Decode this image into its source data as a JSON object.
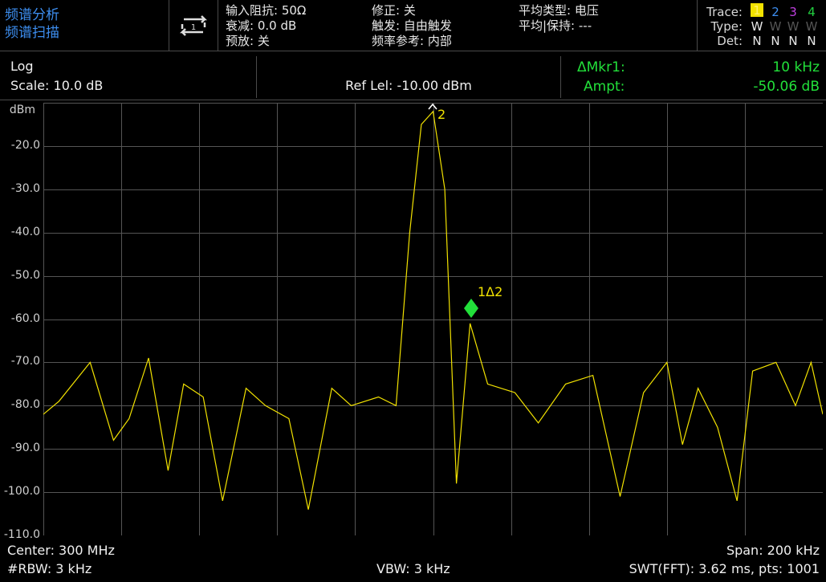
{
  "mode": {
    "line1": "频谱分析",
    "line2": "频谱扫描"
  },
  "status": {
    "col1": [
      "输入阻抗: 50Ω",
      "衰减: 0.0 dB",
      "预放: 关"
    ],
    "col2": [
      "修正: 关",
      "触发: 自由触发",
      "频率参考: 内部"
    ],
    "col3": [
      "平均类型: 电压",
      "平均|保持: ---"
    ]
  },
  "trace_panel": {
    "trace_label": "Trace:",
    "type_label": "Type:",
    "det_label": "Det:",
    "numbers": [
      "1",
      "2",
      "3",
      "4"
    ],
    "types": [
      "W",
      "W",
      "W",
      "W"
    ],
    "dets": [
      "N",
      "N",
      "N",
      "N"
    ],
    "colors": [
      "#f2e200",
      "#3d8ef0",
      "#c040e0",
      "#22d040"
    ]
  },
  "scale": {
    "mode": "Log",
    "scale_text": "Scale: 10.0 dB",
    "ref_level": "Ref Lel: -10.00 dBm"
  },
  "marker_readout": {
    "label": "ΔMkr1:",
    "value": "10 kHz",
    "ampt_label": "Ampt:",
    "ampt_value": "-50.06 dB"
  },
  "y_axis": {
    "unit": "dBm",
    "ticks": [
      "-20.0",
      "-30.0",
      "-40.0",
      "-50.0",
      "-60.0",
      "-70.0",
      "-80.0",
      "-90.0",
      "-100.0",
      "-110.0"
    ]
  },
  "markers": {
    "ref_label": "2",
    "delta_label": "1Δ2"
  },
  "footer": {
    "center": "Center: 300 MHz",
    "rbw": "#RBW: 3 kHz",
    "vbw": "VBW: 3 kHz",
    "span": "Span: 200 kHz",
    "swt": "SWT(FFT): 3.62 ms, pts: 1001"
  },
  "chart_data": {
    "type": "line",
    "xlabel": "",
    "ylabel": "dBm",
    "xlim": [
      299.9,
      300.1
    ],
    "ylim": [
      -110,
      -10
    ],
    "series": [
      {
        "values_x": [
          299.9,
          299.904,
          299.912,
          299.918,
          299.922,
          299.927,
          299.932,
          299.936,
          299.941,
          299.946,
          299.952,
          299.957,
          299.963,
          299.968,
          299.974,
          299.979,
          299.986,
          299.9905,
          299.994,
          299.997,
          300.0,
          300.003,
          300.006,
          300.0095,
          300.014,
          300.021,
          300.027,
          300.034,
          300.041,
          300.048,
          300.054,
          300.06,
          300.064,
          300.068,
          300.073,
          300.078,
          300.082,
          300.088,
          300.093,
          300.097,
          300.1
        ],
        "values_y": [
          -82,
          -79,
          -70,
          -88,
          -83,
          -69,
          -95,
          -75,
          -78,
          -102,
          -76,
          -80,
          -83,
          -104,
          -76,
          -80,
          -78,
          -80,
          -40,
          -15,
          -12,
          -30,
          -98,
          -61,
          -75,
          -77,
          -84,
          -75,
          -73,
          -101,
          -77,
          -70,
          -89,
          -76,
          -85,
          -102,
          -72,
          -70,
          -80,
          -70,
          -82
        ]
      }
    ]
  }
}
